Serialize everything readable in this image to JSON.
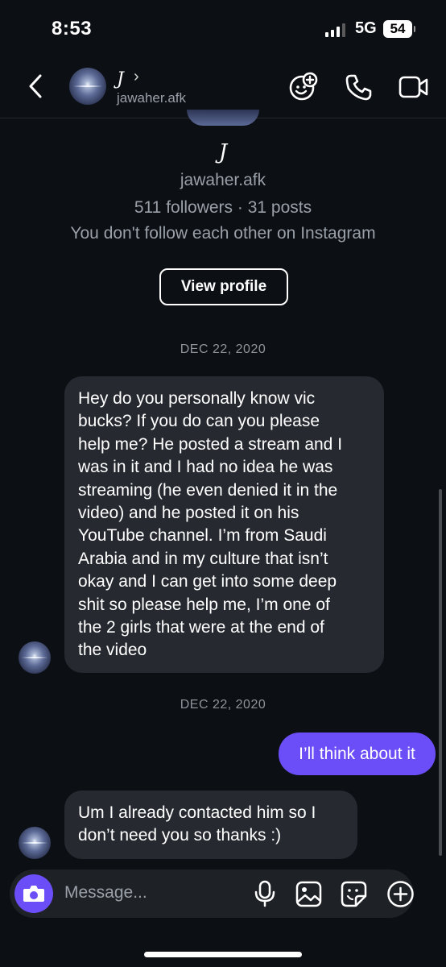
{
  "status_bar": {
    "time": "8:53",
    "network": "5G",
    "battery": "54"
  },
  "header": {
    "name": "J",
    "chevron": "›",
    "username": "jawaher.afk",
    "icons": [
      "back-icon",
      "effects-icon",
      "phone-icon",
      "video-icon"
    ]
  },
  "profile": {
    "name": "J",
    "username": "jawaher.afk",
    "stats": "511 followers · 31 posts",
    "note": "You don't follow each other on Instagram",
    "view_button": "View profile"
  },
  "thread": {
    "date_1": "DEC 22, 2020",
    "msg_1_lines": [
      "Hey do you personally know vic",
      "bucks? If you do can you please",
      "help me? He posted a stream and I",
      "was in it and I had no idea he was",
      "streaming (he even denied it in the",
      "video) and he posted it on his",
      "YouTube channel. I’m from Saudi",
      "Arabia and in my culture that isn’t",
      "okay and I can get into some deep",
      "shit so please help me, I’m one of",
      "the 2 girls that were at the end of",
      "the video"
    ],
    "date_2": "DEC 22, 2020",
    "msg_2": "I’ll think about it",
    "msg_3_lines": [
      "Um I already contacted him so I",
      "don’t need you so thanks :)"
    ]
  },
  "composer": {
    "placeholder": "Message...",
    "icons": [
      "camera-icon",
      "microphone-icon",
      "gallery-icon",
      "sticker-icon",
      "plus-icon"
    ]
  },
  "colors": {
    "background": "#0c0f14",
    "incoming_bubble": "#262a30",
    "outgoing_bubble": "#6b4ef7",
    "secondary_text": "#9aa0a8"
  }
}
